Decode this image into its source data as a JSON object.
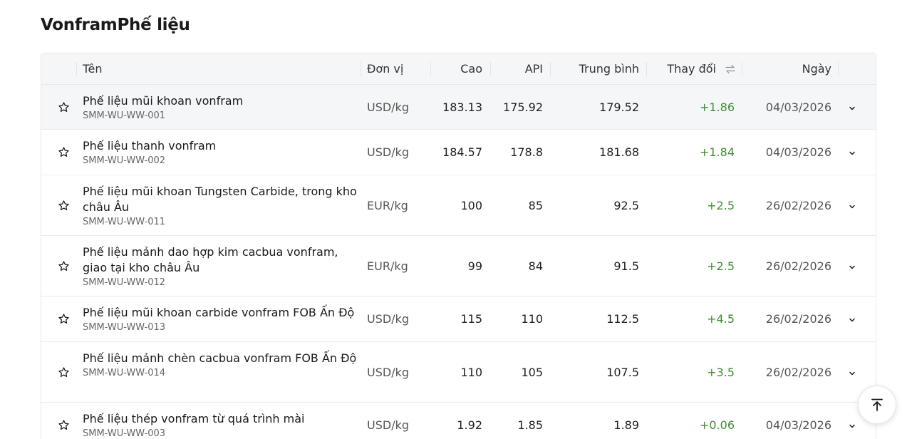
{
  "page": {
    "title": "VonframPhế liệu"
  },
  "table": {
    "columns": {
      "name": "Tên",
      "unit": "Đơn vị",
      "high": "Cao",
      "low": "API",
      "avg": "Trung bình",
      "change": "Thay đổi",
      "date": "Ngày"
    },
    "rows": [
      {
        "name": "Phế liệu mũi khoan vonfram",
        "code": "SMM-WU-WW-001",
        "unit": "USD/kg",
        "high": "183.13",
        "low": "175.92",
        "avg": "179.52",
        "change": "+1.86",
        "date": "04/03/2026"
      },
      {
        "name": "Phế liệu thanh vonfram",
        "code": "SMM-WU-WW-002",
        "unit": "USD/kg",
        "high": "184.57",
        "low": "178.8",
        "avg": "181.68",
        "change": "+1.84",
        "date": "04/03/2026"
      },
      {
        "name": "Phế liệu mũi khoan Tungsten Carbide, trong kho châu Âu",
        "code": "SMM-WU-WW-011",
        "unit": "EUR/kg",
        "high": "100",
        "low": "85",
        "avg": "92.5",
        "change": "+2.5",
        "date": "26/02/2026"
      },
      {
        "name": "Phế liệu mảnh dao hợp kim cacbua vonfram, giao tại kho châu Âu",
        "code": "SMM-WU-WW-012",
        "unit": "EUR/kg",
        "high": "99",
        "low": "84",
        "avg": "91.5",
        "change": "+2.5",
        "date": "26/02/2026"
      },
      {
        "name": "Phế liệu mũi khoan carbide vonfram FOB Ấn Độ",
        "code": "SMM-WU-WW-013",
        "unit": "USD/kg",
        "high": "115",
        "low": "110",
        "avg": "112.5",
        "change": "+4.5",
        "date": "26/02/2026"
      },
      {
        "name": "Phế liệu mảnh chèn cacbua vonfram FOB Ấn Độ",
        "code": "SMM-WU-WW-014",
        "unit": "USD/kg",
        "high": "110",
        "low": "105",
        "avg": "107.5",
        "change": "+3.5",
        "date": "26/02/2026"
      },
      {
        "name": "Phế liệu thép vonfram từ quá trình mài",
        "code": "SMM-WU-WW-003",
        "unit": "USD/kg",
        "high": "1.92",
        "low": "1.85",
        "avg": "1.89",
        "change": "+0.06",
        "date": "04/03/2026"
      }
    ]
  },
  "colors": {
    "positive_change": "#3e8e2f",
    "header_bg": "#f5f6f8",
    "highlight_row_bg": "#f5f6f8"
  },
  "icons": {
    "favorite": "star-icon",
    "expand": "chevron-down-icon",
    "sort": "sort-icon",
    "back_to_top": "arrow-up-to-top-icon"
  }
}
